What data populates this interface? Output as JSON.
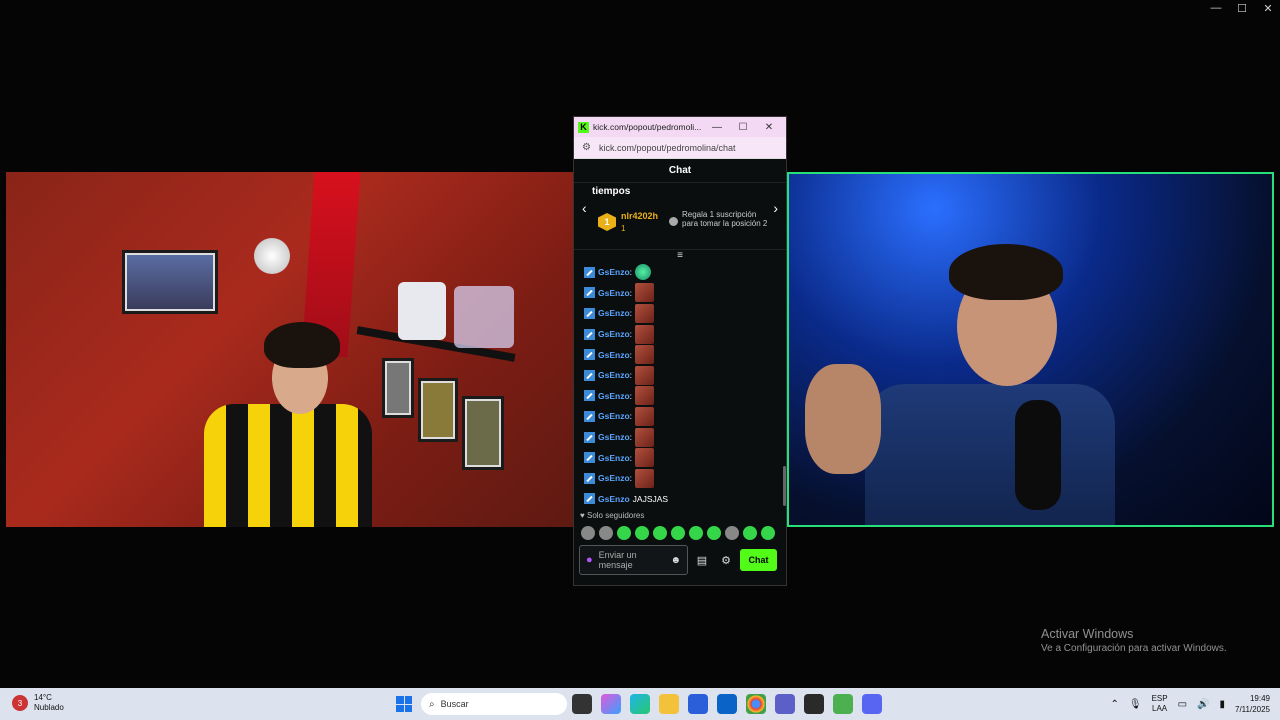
{
  "window_controls": {
    "minimize": "—",
    "maximize": "☐",
    "close": "✕"
  },
  "chat_window": {
    "titlebar": {
      "logo": "K",
      "title": "kick.com/popout/pedromoli...",
      "minimize": "—",
      "maximize": "☐",
      "close": "✕"
    },
    "url": "kick.com/popout/pedromolina/chat",
    "header": "Chat",
    "leaderboard": {
      "label": "tiempos",
      "rank": "1",
      "user": "nlr4202h",
      "count": "1",
      "note": "Regala 1 suscripción para tomar la posición 2"
    },
    "messages": [
      {
        "user": "GsEnzo",
        "emote": "green"
      },
      {
        "user": "GsEnzo",
        "emote": "img"
      },
      {
        "user": "GsEnzo",
        "emote": "img"
      },
      {
        "user": "GsEnzo",
        "emote": "img"
      },
      {
        "user": "GsEnzo",
        "emote": "img"
      },
      {
        "user": "GsEnzo",
        "emote": "img"
      },
      {
        "user": "GsEnzo",
        "emote": "img"
      },
      {
        "user": "GsEnzo",
        "emote": "img"
      },
      {
        "user": "GsEnzo",
        "emote": "img"
      },
      {
        "user": "GsEnzo",
        "emote": "img"
      },
      {
        "user": "GsEnzo",
        "emote": "img"
      },
      {
        "user": "GsEnzo",
        "text": "JAJSJAS"
      }
    ],
    "followers_only": "Solo seguidores",
    "input_placeholder": "Enviar un mensaje",
    "send_label": "Chat"
  },
  "watermark": {
    "line1": "Activar Windows",
    "line2": "Ve a Configuración para activar Windows."
  },
  "taskbar": {
    "weather_badge": "3",
    "temperature": "14°C",
    "condition": "Nublado",
    "search_placeholder": "Buscar",
    "lang_1": "ESP",
    "lang_2": "LAA",
    "time": "19:49",
    "date": "7/11/2025"
  }
}
